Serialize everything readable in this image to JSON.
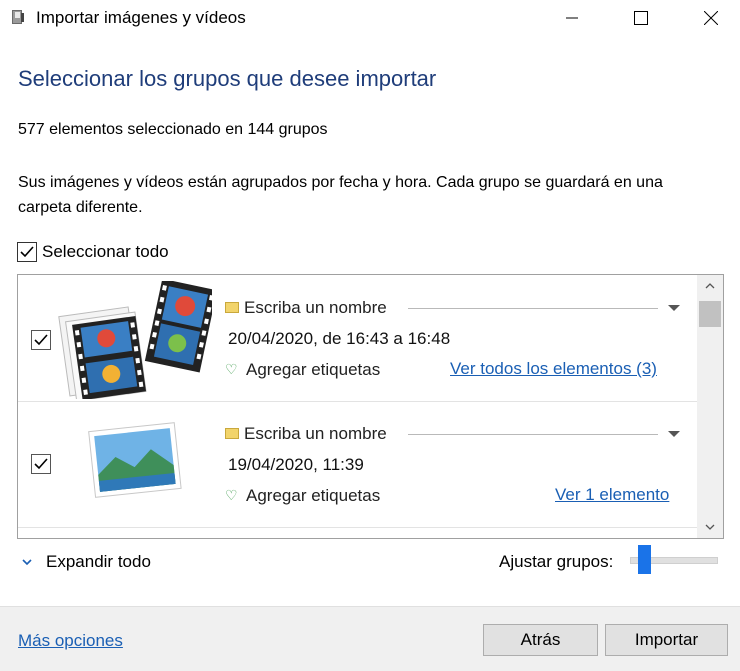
{
  "window": {
    "title": "Importar imágenes y vídeos",
    "minimize_icon": "minimize-icon",
    "maximize_icon": "maximize-icon",
    "close_icon": "close-icon"
  },
  "heading": "Seleccionar los grupos que desee importar",
  "summary": "577 elementos seleccionado en 144 grupos",
  "description": "Sus imágenes y vídeos están agrupados por fecha y hora. Cada grupo se guardará en una carpeta diferente.",
  "select_all": {
    "label": "Seleccionar todo",
    "checked": true
  },
  "groups": [
    {
      "checked": true,
      "thumbnail": "video-film-thumbnail",
      "name_placeholder": "Escriba un nombre",
      "date": "20/04/2020, de 16:43 a 16:48",
      "tags_label": "Agregar etiquetas",
      "view_link": "Ver todos los elementos (3)"
    },
    {
      "checked": true,
      "thumbnail": "landscape-photo-thumbnail",
      "name_placeholder": "Escriba un nombre",
      "date": "19/04/2020, 11:39",
      "tags_label": "Agregar etiquetas",
      "view_link": "Ver 1 elemento"
    }
  ],
  "expand_all": "Expandir todo",
  "adjust_groups": {
    "label": "Ajustar grupos:",
    "level": 0.1
  },
  "more_options": "Más opciones",
  "buttons": {
    "back": "Atrás",
    "import": "Importar"
  },
  "colors": {
    "heading": "#1f3d7a",
    "link": "#1a5fb4",
    "slider": "#1a73e8"
  }
}
